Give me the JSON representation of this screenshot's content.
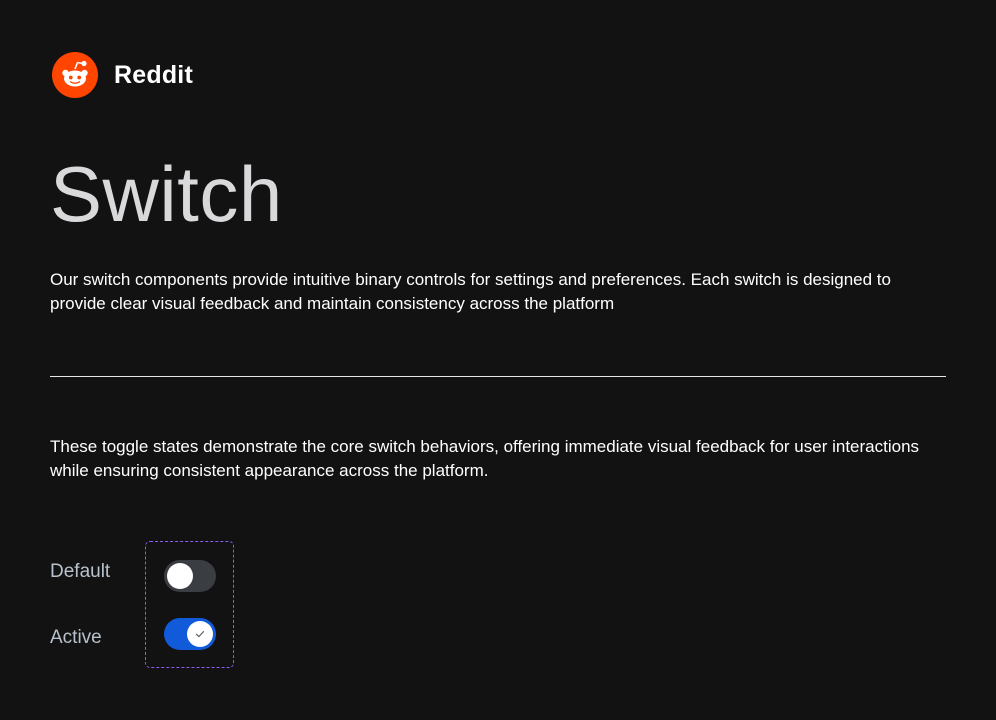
{
  "brand": {
    "name": "Reddit",
    "logo_icon": "reddit-snoo-icon",
    "logo_color": "#FF4500"
  },
  "page": {
    "title": "Switch",
    "intro": "Our switch components provide intuitive binary controls for settings and preferences. Each switch is designed to provide clear visual feedback and maintain consistency across the platform"
  },
  "section": {
    "description": "These toggle states demonstrate the core switch behaviors, offering immediate visual feedback for user interactions while ensuring consistent appearance across the platform."
  },
  "switches": [
    {
      "label": "Default",
      "checked": false,
      "track_color": "#3A3D41"
    },
    {
      "label": "Active",
      "checked": true,
      "track_color": "#115BDB",
      "icon": "check-icon"
    }
  ],
  "colors": {
    "background": "#121212",
    "frame_border": "#8B5CF6"
  }
}
